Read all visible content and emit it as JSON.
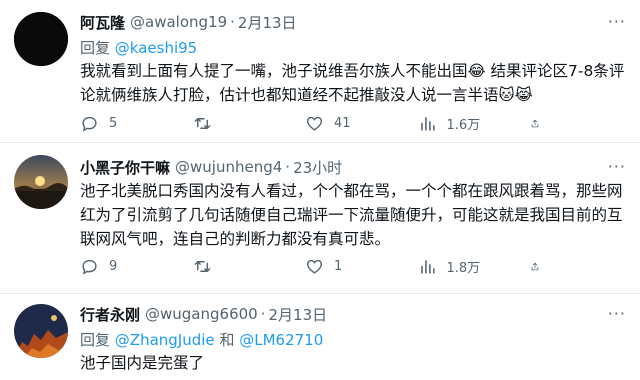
{
  "tweets": [
    {
      "name": "阿瓦隆",
      "handle": "@awalong19",
      "dot": "·",
      "time": "2月13日",
      "reply_prefix": "回复",
      "mentions": [
        "@kaeshi95"
      ],
      "joiner": "",
      "text": "我就看到上面有人提了一嘴，池子说维吾尔族人不能出国😂 结果评论区7-8条评论就俩维族人打脸，估计也都知道经不起推敲没人说一言半语🐱😹",
      "reply_count": "5",
      "retweet_count": "",
      "like_count": "41",
      "view_count": "1.6万"
    },
    {
      "name": "小黑子你干嘛",
      "handle": "@wujunheng4",
      "dot": "·",
      "time": "23小时",
      "text": "池子北美脱口秀国内没有人看过，个个都在骂，一个个都在跟风跟着骂，那些网红为了引流剪了几句话随便自己瑞评一下流量随便升，可能这就是我国目前的互联网风气吧，连自己的判断力都没有真可悲。",
      "reply_count": "9",
      "retweet_count": "",
      "like_count": "1",
      "view_count": "1.8万"
    },
    {
      "name": "行者永刚",
      "handle": "@wugang6600",
      "dot": "·",
      "time": "2月13日",
      "reply_prefix": "回复",
      "mentions": [
        "@ZhangJudie",
        "@LM62710"
      ],
      "joiner": "和",
      "text": "池子国内是完蛋了"
    }
  ],
  "more_label": "···",
  "colors": {
    "accent": "#1d9bf0",
    "muted": "#536471",
    "text": "#0f1419"
  },
  "icons": [
    "reply-icon",
    "retweet-icon",
    "like-icon",
    "views-icon",
    "share-icon",
    "more-icon"
  ]
}
